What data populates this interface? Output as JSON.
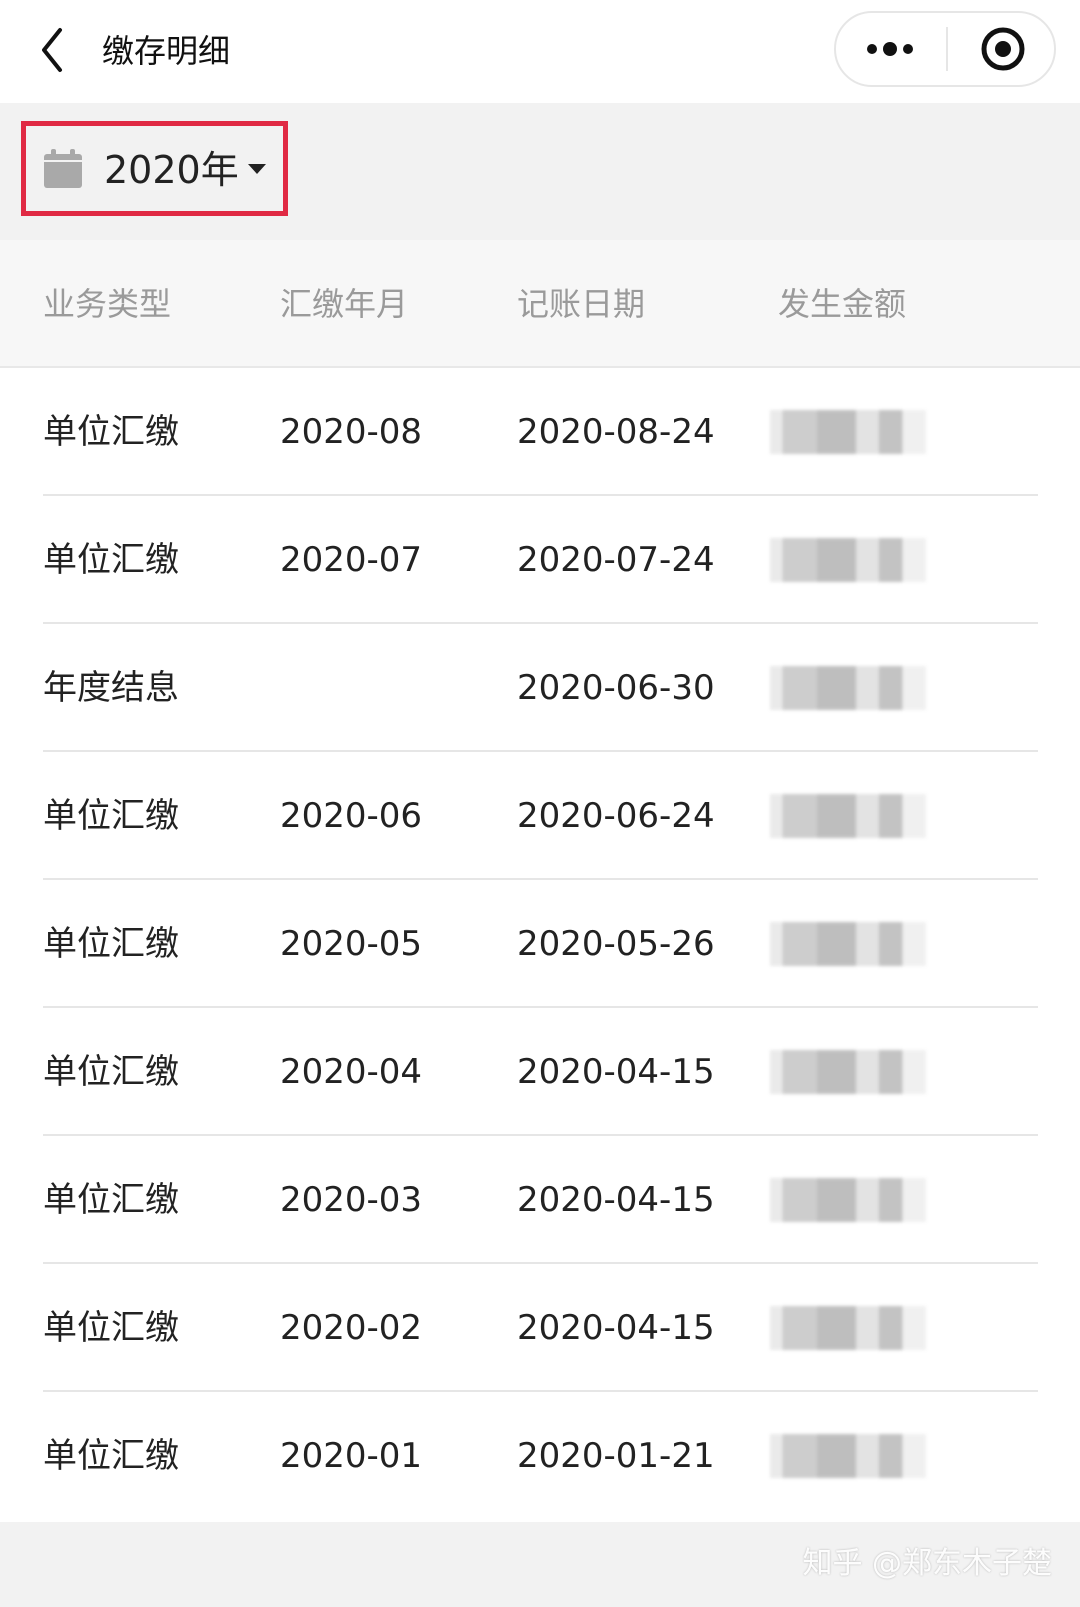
{
  "header": {
    "title": "缴存明细",
    "back_icon": "chevron-left-icon",
    "more_icon": "more-dots-icon",
    "close_icon": "target-circle-icon"
  },
  "filter": {
    "year_label": "2020年",
    "calendar_icon": "calendar-icon",
    "caret_icon": "caret-down-icon",
    "highlight_color": "#e02a44"
  },
  "table": {
    "columns": [
      "业务类型",
      "汇缴年月",
      "记账日期",
      "发生金额"
    ],
    "rows": [
      {
        "type": "单位汇缴",
        "month": "2020-08",
        "date": "2020-08-24"
      },
      {
        "type": "单位汇缴",
        "month": "2020-07",
        "date": "2020-07-24"
      },
      {
        "type": "年度结息",
        "month": "",
        "date": "2020-06-30"
      },
      {
        "type": "单位汇缴",
        "month": "2020-06",
        "date": "2020-06-24"
      },
      {
        "type": "单位汇缴",
        "month": "2020-05",
        "date": "2020-05-26"
      },
      {
        "type": "单位汇缴",
        "month": "2020-04",
        "date": "2020-04-15"
      },
      {
        "type": "单位汇缴",
        "month": "2020-03",
        "date": "2020-04-15"
      },
      {
        "type": "单位汇缴",
        "month": "2020-02",
        "date": "2020-04-15"
      },
      {
        "type": "单位汇缴",
        "month": "2020-01",
        "date": "2020-01-21"
      }
    ]
  },
  "watermark": "知乎 @郑东木子楚"
}
